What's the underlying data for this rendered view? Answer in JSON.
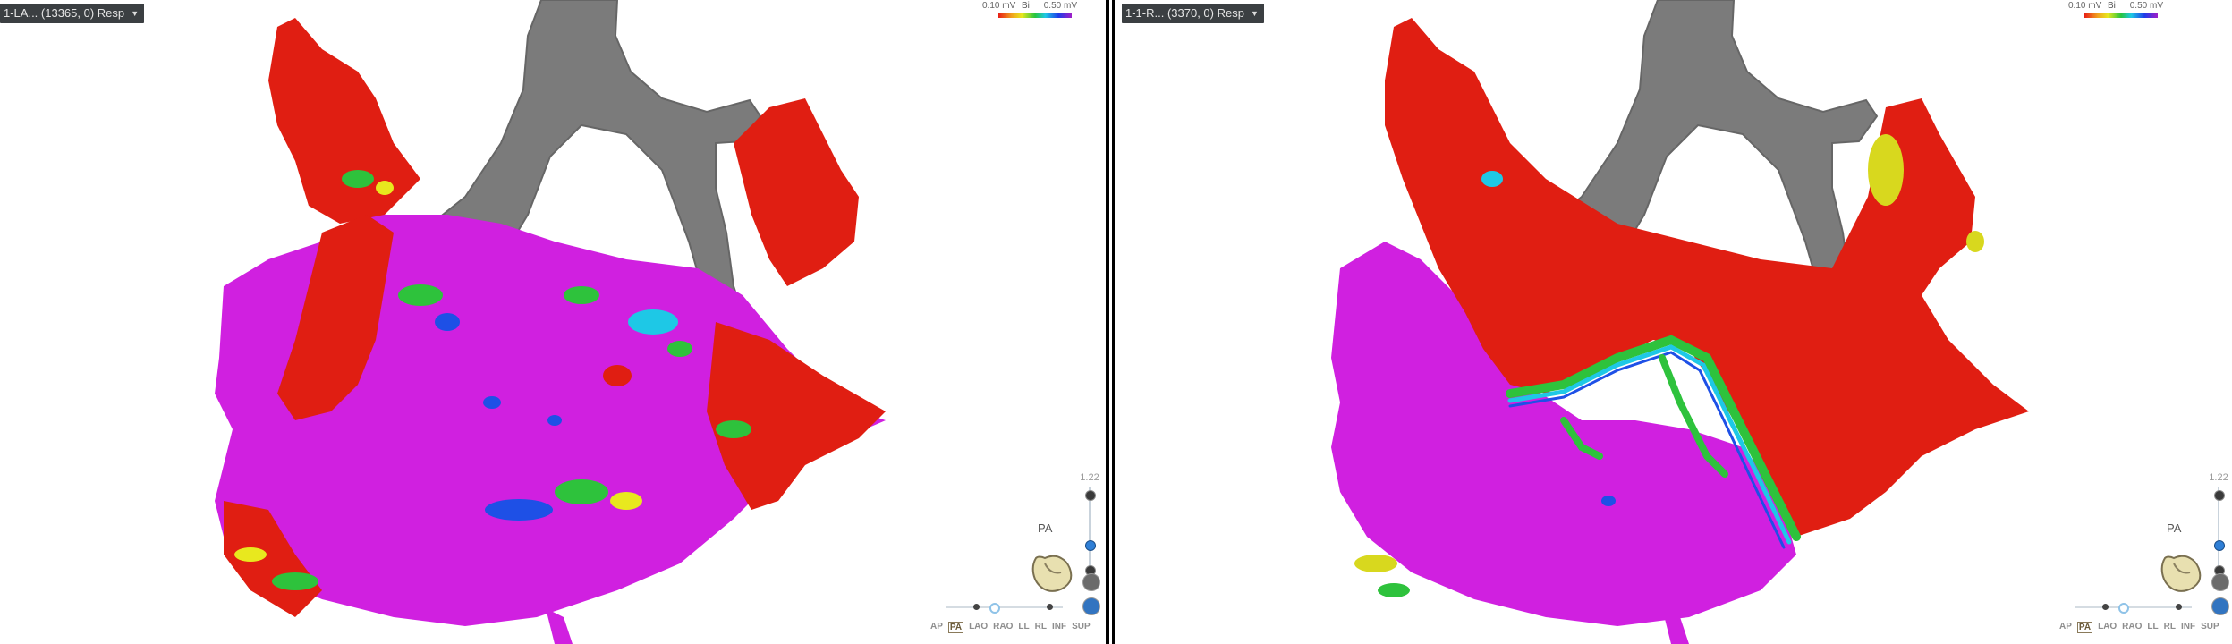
{
  "left": {
    "map_name": "1-LA... (13365, 0) Resp",
    "colorbar": {
      "min": "0.10 mV",
      "mode": "Bi",
      "max": "0.50 mV"
    },
    "zoom_value": "1.22",
    "orientation": "PA",
    "view_buttons": [
      "AP",
      "PA",
      "LAO",
      "RAO",
      "LL",
      "RL",
      "INF",
      "SUP"
    ],
    "active_view": "PA"
  },
  "right": {
    "map_name": "1-1-R... (3370, 0) Resp",
    "colorbar": {
      "min": "0.10 mV",
      "mode": "Bi",
      "max": "0.50 mV"
    },
    "zoom_value": "1.22",
    "orientation": "PA",
    "view_buttons": [
      "AP",
      "PA",
      "LAO",
      "RAO",
      "LL",
      "RL",
      "INF",
      "SUP"
    ],
    "active_view": "PA"
  },
  "colors": {
    "scar": "#e01e12",
    "healthy": "#d21ee0",
    "border_green": "#2ec23c",
    "border_blue": "#1e50e6",
    "vessel_gray": "#6e6e6e",
    "title_bg": "#3b3f42"
  }
}
